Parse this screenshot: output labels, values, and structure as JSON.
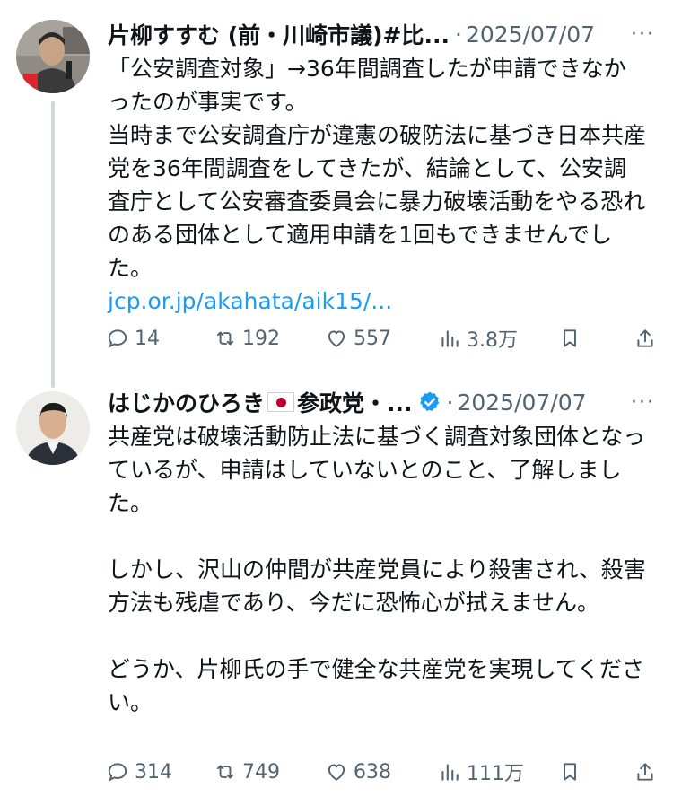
{
  "tweets": [
    {
      "author_name": "片柳すすむ (前・川崎市議)#比...",
      "date": "2025/07/07",
      "more_label": "···",
      "text": "「公安調査対象」→36年間調査したが申請できなかったのが事実です。\n当時まで公安調査庁が違憲の破防法に基づき日本共産党を36年間調査をしてきたが、結論として、公安調査庁として公安審査委員会に暴力破壊活動をやる恐れのある団体として適用申請を1回もできませんでした。",
      "link": "jcp.or.jp/akahata/aik15/...",
      "stats": {
        "replies": "14",
        "retweets": "192",
        "likes": "557",
        "views": "3.8万"
      }
    },
    {
      "author_name": "はじかのひろき",
      "author_name_suffix": "参政党・...",
      "verified": true,
      "date": "2025/07/07",
      "more_label": "···",
      "text": "共産党は破壊活動防止法に基づく調査対象団体となっているが、申請はしていないとのこと、了解しました。\n\nしかし、沢山の仲間が共産党員により殺害され、殺害方法も残虐であり、今だに恐怖心が拭えません。\n\nどうか、片柳氏の手で健全な共産党を実現してください。",
      "stats": {
        "replies": "314",
        "retweets": "749",
        "likes": "638",
        "views": "111万"
      }
    }
  ],
  "separator": "·",
  "colors": {
    "link": "#1d9bf0",
    "secondary": "#536471",
    "verified": "#1d9bf0",
    "thread_line": "#cfd9de"
  },
  "icons": [
    "reply-icon",
    "retweet-icon",
    "like-icon",
    "views-icon",
    "bookmark-icon",
    "share-icon",
    "verified-badge-icon",
    "japan-flag-icon"
  ]
}
